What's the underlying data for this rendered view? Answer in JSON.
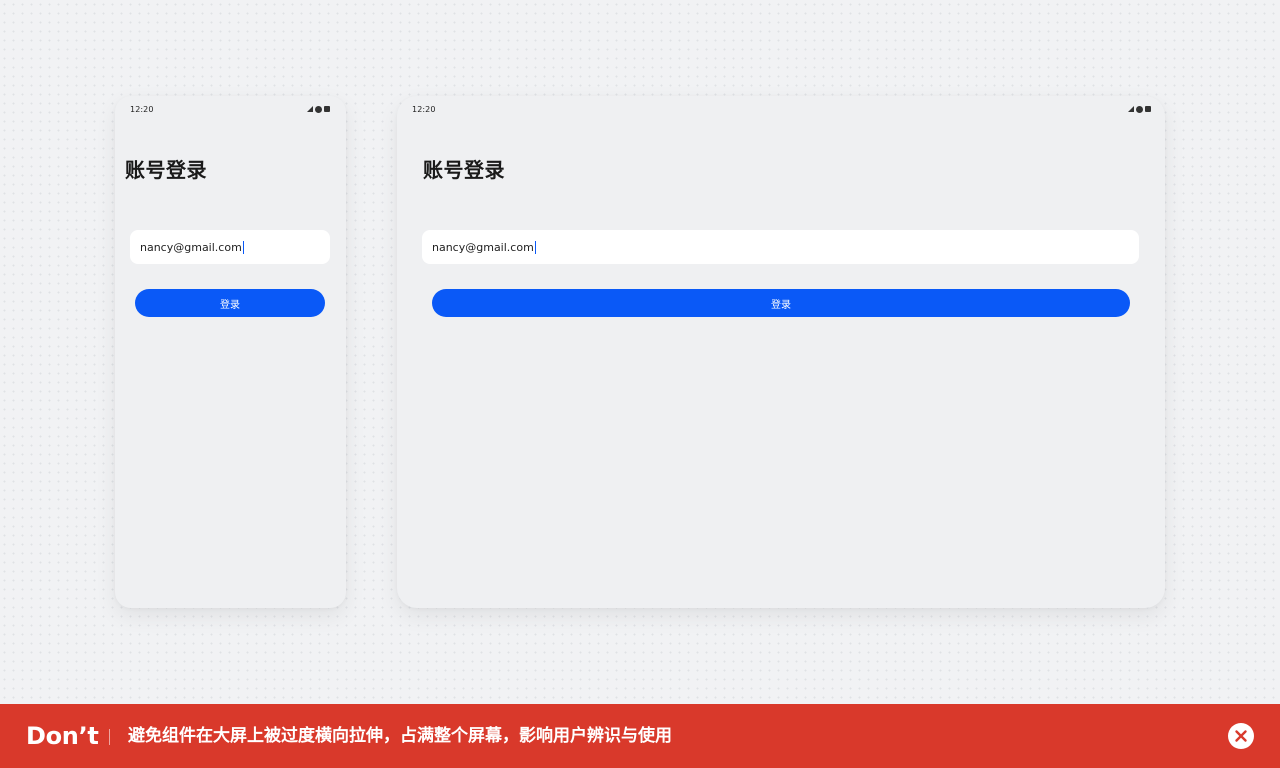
{
  "phone": {
    "status_time": "12:20",
    "title": "账号登录",
    "email_value": "nancy@gmail.com",
    "login_label": "登录"
  },
  "tablet": {
    "status_time": "12:20",
    "title": "账号登录",
    "email_value": "nancy@gmail.com",
    "login_label": "登录"
  },
  "banner": {
    "label": "Don’t",
    "message": "避免组件在大屏上被过度横向拉伸，占满整个屏幕，影响用户辨识与使用"
  },
  "icons": {
    "status": [
      "signal-icon",
      "wifi-dot-icon",
      "battery-icon"
    ],
    "banner_close": "close-icon"
  },
  "colors": {
    "accent": "#0a59f7",
    "banner_bg": "#d9392b",
    "device_bg": "#eff0f2",
    "page_bg": "#f1f2f4"
  }
}
